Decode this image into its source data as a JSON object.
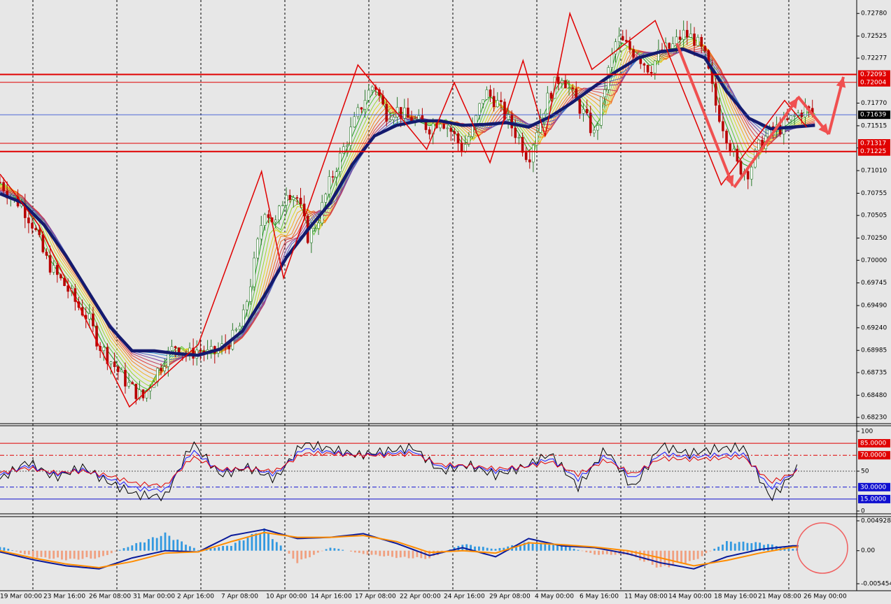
{
  "chart_data": [
    {
      "panel": "price",
      "type": "candlestick",
      "ylim": [
        0.6816,
        0.729
      ],
      "y_ticks": [
        "0.72780",
        "0.72525",
        "0.72277",
        "0.71770",
        "0.71515",
        "0.71265",
        "0.71010",
        "0.70755",
        "0.70505",
        "0.70250",
        "0.70000",
        "0.69745",
        "0.69490",
        "0.69240",
        "0.68985",
        "0.68735",
        "0.68480",
        "0.68230"
      ],
      "tick_values": [
        0.7278,
        0.72525,
        0.72277,
        0.7177,
        0.71515,
        0.71265,
        0.7101,
        0.70755,
        0.70505,
        0.7025,
        0.7,
        0.69745,
        0.6949,
        0.6924,
        0.68985,
        0.68735,
        0.6848,
        0.6823
      ],
      "levels": [
        {
          "label": "0.72093",
          "value": 0.72093,
          "color": "#e00000"
        },
        {
          "label": "0.72004",
          "value": 0.72004,
          "color": "#e00000"
        },
        {
          "label": "0.71317",
          "value": 0.71317,
          "color": "#e00000"
        },
        {
          "label": "0.71225",
          "value": 0.71225,
          "color": "#e00000"
        }
      ],
      "current_price": {
        "label": "0.71639",
        "value": 0.71639,
        "color": "#1a3fd0"
      },
      "x_labels": [
        "19 Mar 00:00",
        "23 Mar 16:00",
        "26 Mar 08:00",
        "31 Mar 00:00",
        "2 Apr 16:00",
        "7 Apr 08:00",
        "10 Apr 00:00",
        "14 Apr 16:00",
        "17 Apr 08:00",
        "22 Apr 00:00",
        "24 Apr 16:00",
        "29 Apr 08:00",
        "4 May 00:00",
        "6 May 16:00",
        "11 May 08:00",
        "14 May 00:00",
        "18 May 16:00",
        "21 May 08:00",
        "26 May 00:00"
      ],
      "series": [
        {
          "name": "",
          "kind": "close",
          "x": [
            0,
            4,
            8,
            12,
            16,
            20,
            24,
            28,
            32,
            36,
            40,
            44,
            48,
            52,
            56,
            60,
            64,
            68,
            72,
            76,
            80,
            84,
            88,
            92,
            96,
            100,
            104,
            108,
            112,
            116,
            120,
            124,
            128,
            132,
            136,
            140,
            144,
            148,
            152,
            156,
            160,
            164,
            168,
            172,
            176,
            180,
            184,
            188,
            192,
            196,
            200,
            204,
            208,
            212,
            216,
            220,
            224,
            228,
            232,
            236,
            240,
            244,
            248,
            252,
            256,
            260,
            264,
            268,
            272,
            276,
            280,
            284,
            288,
            292,
            296
          ],
          "y": [
            0.7088,
            0.7072,
            0.7062,
            0.704,
            0.7005,
            0.6985,
            0.697,
            0.695,
            0.6935,
            0.6905,
            0.6888,
            0.687,
            0.6855,
            0.6845,
            0.687,
            0.689,
            0.6905,
            0.6892,
            0.69,
            0.6893,
            0.69,
            0.691,
            0.693,
            0.699,
            0.706,
            0.704,
            0.708,
            0.707,
            0.7025,
            0.705,
            0.709,
            0.712,
            0.715,
            0.718,
            0.72,
            0.7165,
            0.717,
            0.716,
            0.7155,
            0.715,
            0.716,
            0.7145,
            0.7125,
            0.715,
            0.719,
            0.718,
            0.716,
            0.714,
            0.7115,
            0.716,
            0.719,
            0.721,
            0.7185,
            0.7165,
            0.714,
            0.72,
            0.725,
            0.724,
            0.723,
            0.7215,
            0.7235,
            0.724,
            0.7255,
            0.725,
            0.723,
            0.7175,
            0.714,
            0.7105,
            0.71,
            0.713,
            0.7145,
            0.715,
            0.716,
            0.717,
            0.7165
          ]
        },
        {
          "name": "",
          "kind": "slow moving average",
          "x": [
            0,
            8,
            16,
            24,
            32,
            40,
            48,
            56,
            64,
            72,
            80,
            88,
            96,
            104,
            112,
            120,
            128,
            136,
            144,
            152,
            160,
            168,
            176,
            184,
            192,
            200,
            208,
            216,
            224,
            232,
            240,
            248,
            256,
            264,
            272,
            280,
            288,
            296
          ],
          "y": [
            0.7075,
            0.7065,
            0.704,
            0.7005,
            0.6965,
            0.6925,
            0.6898,
            0.6898,
            0.6895,
            0.6893,
            0.69,
            0.692,
            0.696,
            0.7003,
            0.7035,
            0.7065,
            0.7108,
            0.714,
            0.7152,
            0.7157,
            0.7157,
            0.7152,
            0.7153,
            0.7155,
            0.715,
            0.7162,
            0.7178,
            0.7196,
            0.7213,
            0.7228,
            0.7235,
            0.7238,
            0.7228,
            0.719,
            0.716,
            0.7148,
            0.715,
            0.7152
          ]
        }
      ]
    },
    {
      "panel": "oscillator",
      "type": "line",
      "ylim": [
        0,
        100
      ],
      "y_ticks": [
        "100",
        "50",
        "0"
      ],
      "tick_values": [
        100,
        50,
        0
      ],
      "levels": [
        {
          "label": "85.0000",
          "value": 85,
          "color": "#e00000"
        },
        {
          "label": "70.0000",
          "value": 70,
          "color": "#e00000"
        },
        {
          "label": "30.0000",
          "value": 30,
          "color": "#1010d0"
        },
        {
          "label": "15.0000",
          "value": 15,
          "color": "#1010d0"
        }
      ],
      "series": [
        {
          "name": "",
          "color": "#000000",
          "x": [
            0,
            10,
            20,
            30,
            40,
            50,
            60,
            70,
            80,
            90,
            100,
            110,
            120,
            130,
            140,
            150,
            160,
            170,
            180,
            190,
            200,
            210,
            220,
            230,
            240,
            250,
            260,
            270,
            280,
            290
          ],
          "y": [
            40,
            62,
            42,
            55,
            35,
            20,
            18,
            86,
            45,
            55,
            40,
            85,
            78,
            70,
            75,
            80,
            50,
            58,
            45,
            55,
            72,
            30,
            78,
            28,
            82,
            72,
            78,
            80,
            15,
            55
          ]
        },
        {
          "name": "",
          "color": "#1a1aff",
          "x": [
            0,
            10,
            20,
            30,
            40,
            50,
            60,
            70,
            80,
            90,
            100,
            110,
            120,
            130,
            140,
            150,
            160,
            170,
            180,
            190,
            200,
            210,
            220,
            230,
            240,
            250,
            260,
            270,
            280,
            290
          ],
          "y": [
            45,
            57,
            46,
            52,
            40,
            28,
            26,
            76,
            50,
            54,
            46,
            78,
            74,
            70,
            72,
            75,
            55,
            57,
            50,
            55,
            66,
            40,
            70,
            40,
            72,
            68,
            70,
            72,
            28,
            52
          ]
        },
        {
          "name": "",
          "color": "#e00000",
          "x": [
            0,
            10,
            20,
            30,
            40,
            50,
            60,
            70,
            80,
            90,
            100,
            110,
            120,
            130,
            140,
            150,
            160,
            170,
            180,
            190,
            200,
            210,
            220,
            230,
            240,
            250,
            260,
            270,
            280,
            290
          ],
          "y": [
            48,
            54,
            48,
            50,
            44,
            34,
            32,
            68,
            52,
            53,
            50,
            72,
            72,
            70,
            70,
            72,
            58,
            57,
            53,
            55,
            62,
            46,
            64,
            46,
            66,
            65,
            66,
            68,
            36,
            50
          ]
        }
      ]
    },
    {
      "panel": "macd",
      "type": "bar+line",
      "ylim": [
        -0.005454,
        0.0049282
      ],
      "y_ticks": [
        "0.0049282",
        "0.00",
        "-0.005454"
      ],
      "tick_values": [
        0.0049282,
        0,
        -0.005454
      ],
      "series": [
        {
          "name": "",
          "kind": "histogram",
          "x": [
            0,
            12,
            24,
            36,
            48,
            60,
            72,
            84,
            96,
            108,
            120,
            132,
            144,
            156,
            168,
            180,
            192,
            204,
            216,
            228,
            240,
            252,
            264,
            276,
            288
          ],
          "y": [
            0.0008,
            -0.0011,
            -0.0016,
            -0.0013,
            0.001,
            0.003,
            0.0001,
            0.001,
            0.0038,
            -0.0021,
            0.0006,
            -0.0006,
            -0.0012,
            -0.0014,
            0.0012,
            0.0003,
            0.0015,
            0.001,
            -0.0007,
            -0.0007,
            -0.0031,
            -0.0018,
            0.0016,
            0.0014,
            0.0004
          ]
        },
        {
          "name": "",
          "kind": "line",
          "color": "#0a1a9a",
          "x": [
            0,
            12,
            24,
            36,
            48,
            60,
            72,
            84,
            96,
            108,
            120,
            132,
            144,
            156,
            168,
            180,
            192,
            204,
            216,
            228,
            240,
            252,
            264,
            276,
            288
          ],
          "y": [
            -0.0002,
            -0.0015,
            -0.0025,
            -0.003,
            -0.0012,
            0.0,
            -0.0002,
            0.0025,
            0.0035,
            0.002,
            0.0022,
            0.0028,
            0.0012,
            -0.0008,
            0.0005,
            -0.001,
            0.002,
            0.0008,
            0.0005,
            -0.0005,
            -0.002,
            -0.003,
            -0.001,
            0.0002,
            0.0008
          ]
        },
        {
          "name": "",
          "kind": "line",
          "color": "#ff8c00",
          "x": [
            0,
            12,
            24,
            36,
            48,
            60,
            72,
            84,
            96,
            108,
            120,
            132,
            144,
            156,
            168,
            180,
            192,
            204,
            216,
            228,
            240,
            252,
            264,
            276,
            288
          ],
          "y": [
            0.0,
            -0.0012,
            -0.0022,
            -0.0028,
            -0.0018,
            -0.0004,
            -0.0002,
            0.0015,
            0.003,
            0.0022,
            0.0022,
            0.0025,
            0.0015,
            -0.0003,
            0.0,
            -0.0004,
            0.0013,
            0.001,
            0.0006,
            0.0,
            -0.0012,
            -0.0025,
            -0.0016,
            -0.0004,
            0.0006
          ]
        }
      ]
    }
  ],
  "colors": {
    "background": "#e7e7e7",
    "grid": "#000000",
    "bull": "#2b7a2b",
    "bear": "#b80000",
    "zigzag": "#e00000",
    "arrow": "#f05050",
    "slow_ma": "#141a6e",
    "macd_up": "#3399e0",
    "macd_down": "#f0a080",
    "circle": "#f06060"
  }
}
